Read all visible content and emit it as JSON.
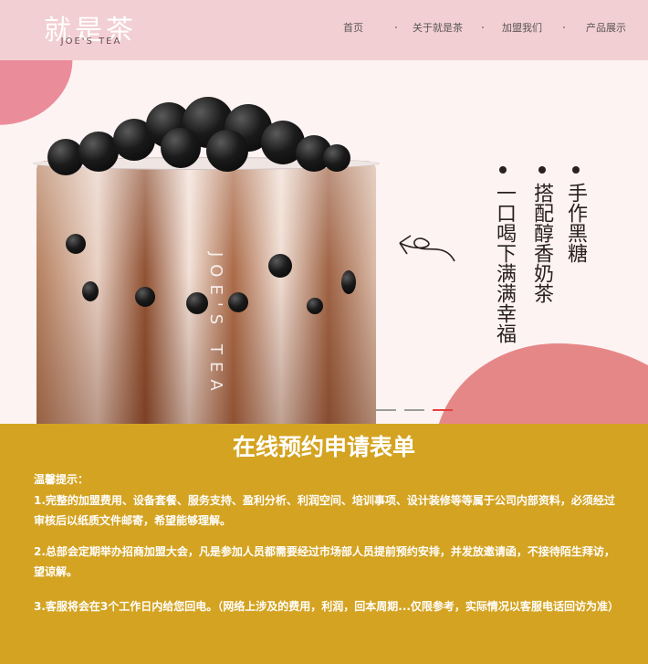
{
  "header": {
    "logo_cn": "就是茶",
    "logo_en": "JOE'S TEA",
    "nav": [
      "首页",
      "关于就是茶",
      "加盟我们",
      "产品展示"
    ]
  },
  "hero": {
    "cup_text": "JOE'S TEA",
    "slogan_columns": [
      "手作黑糖",
      "搭配醇香奶茶",
      "一口喝下满满幸福"
    ],
    "slides_total": 3,
    "active_slide": 3
  },
  "form": {
    "title": "在线预约申请表单",
    "tip_heading": "温馨提示：",
    "tips": [
      "1.完整的加盟费用、设备套餐、服务支持、盈利分析、利润空间、培训事项、设计装修等等属于公司内部资料，必须经过审核后以纸质文件邮寄，希望能够理解。",
      "2.总部会定期举办招商加盟大会，凡是参加人员都需要经过市场部人员提前预约安排，并发放邀请函，不接待陌生拜访，望谅解。",
      "3.客服将会在3个工作日内给您回电。（网络上涉及的费用，利润，回本周期...仅限参考，实际情况以客服电话回访为准）"
    ]
  },
  "colors": {
    "header_bg": "#f2cfd3",
    "hero_bg": "#fdf3f2",
    "form_bg": "#d4a321",
    "accent_red": "#e54040",
    "blob_pink": "#e68787"
  }
}
